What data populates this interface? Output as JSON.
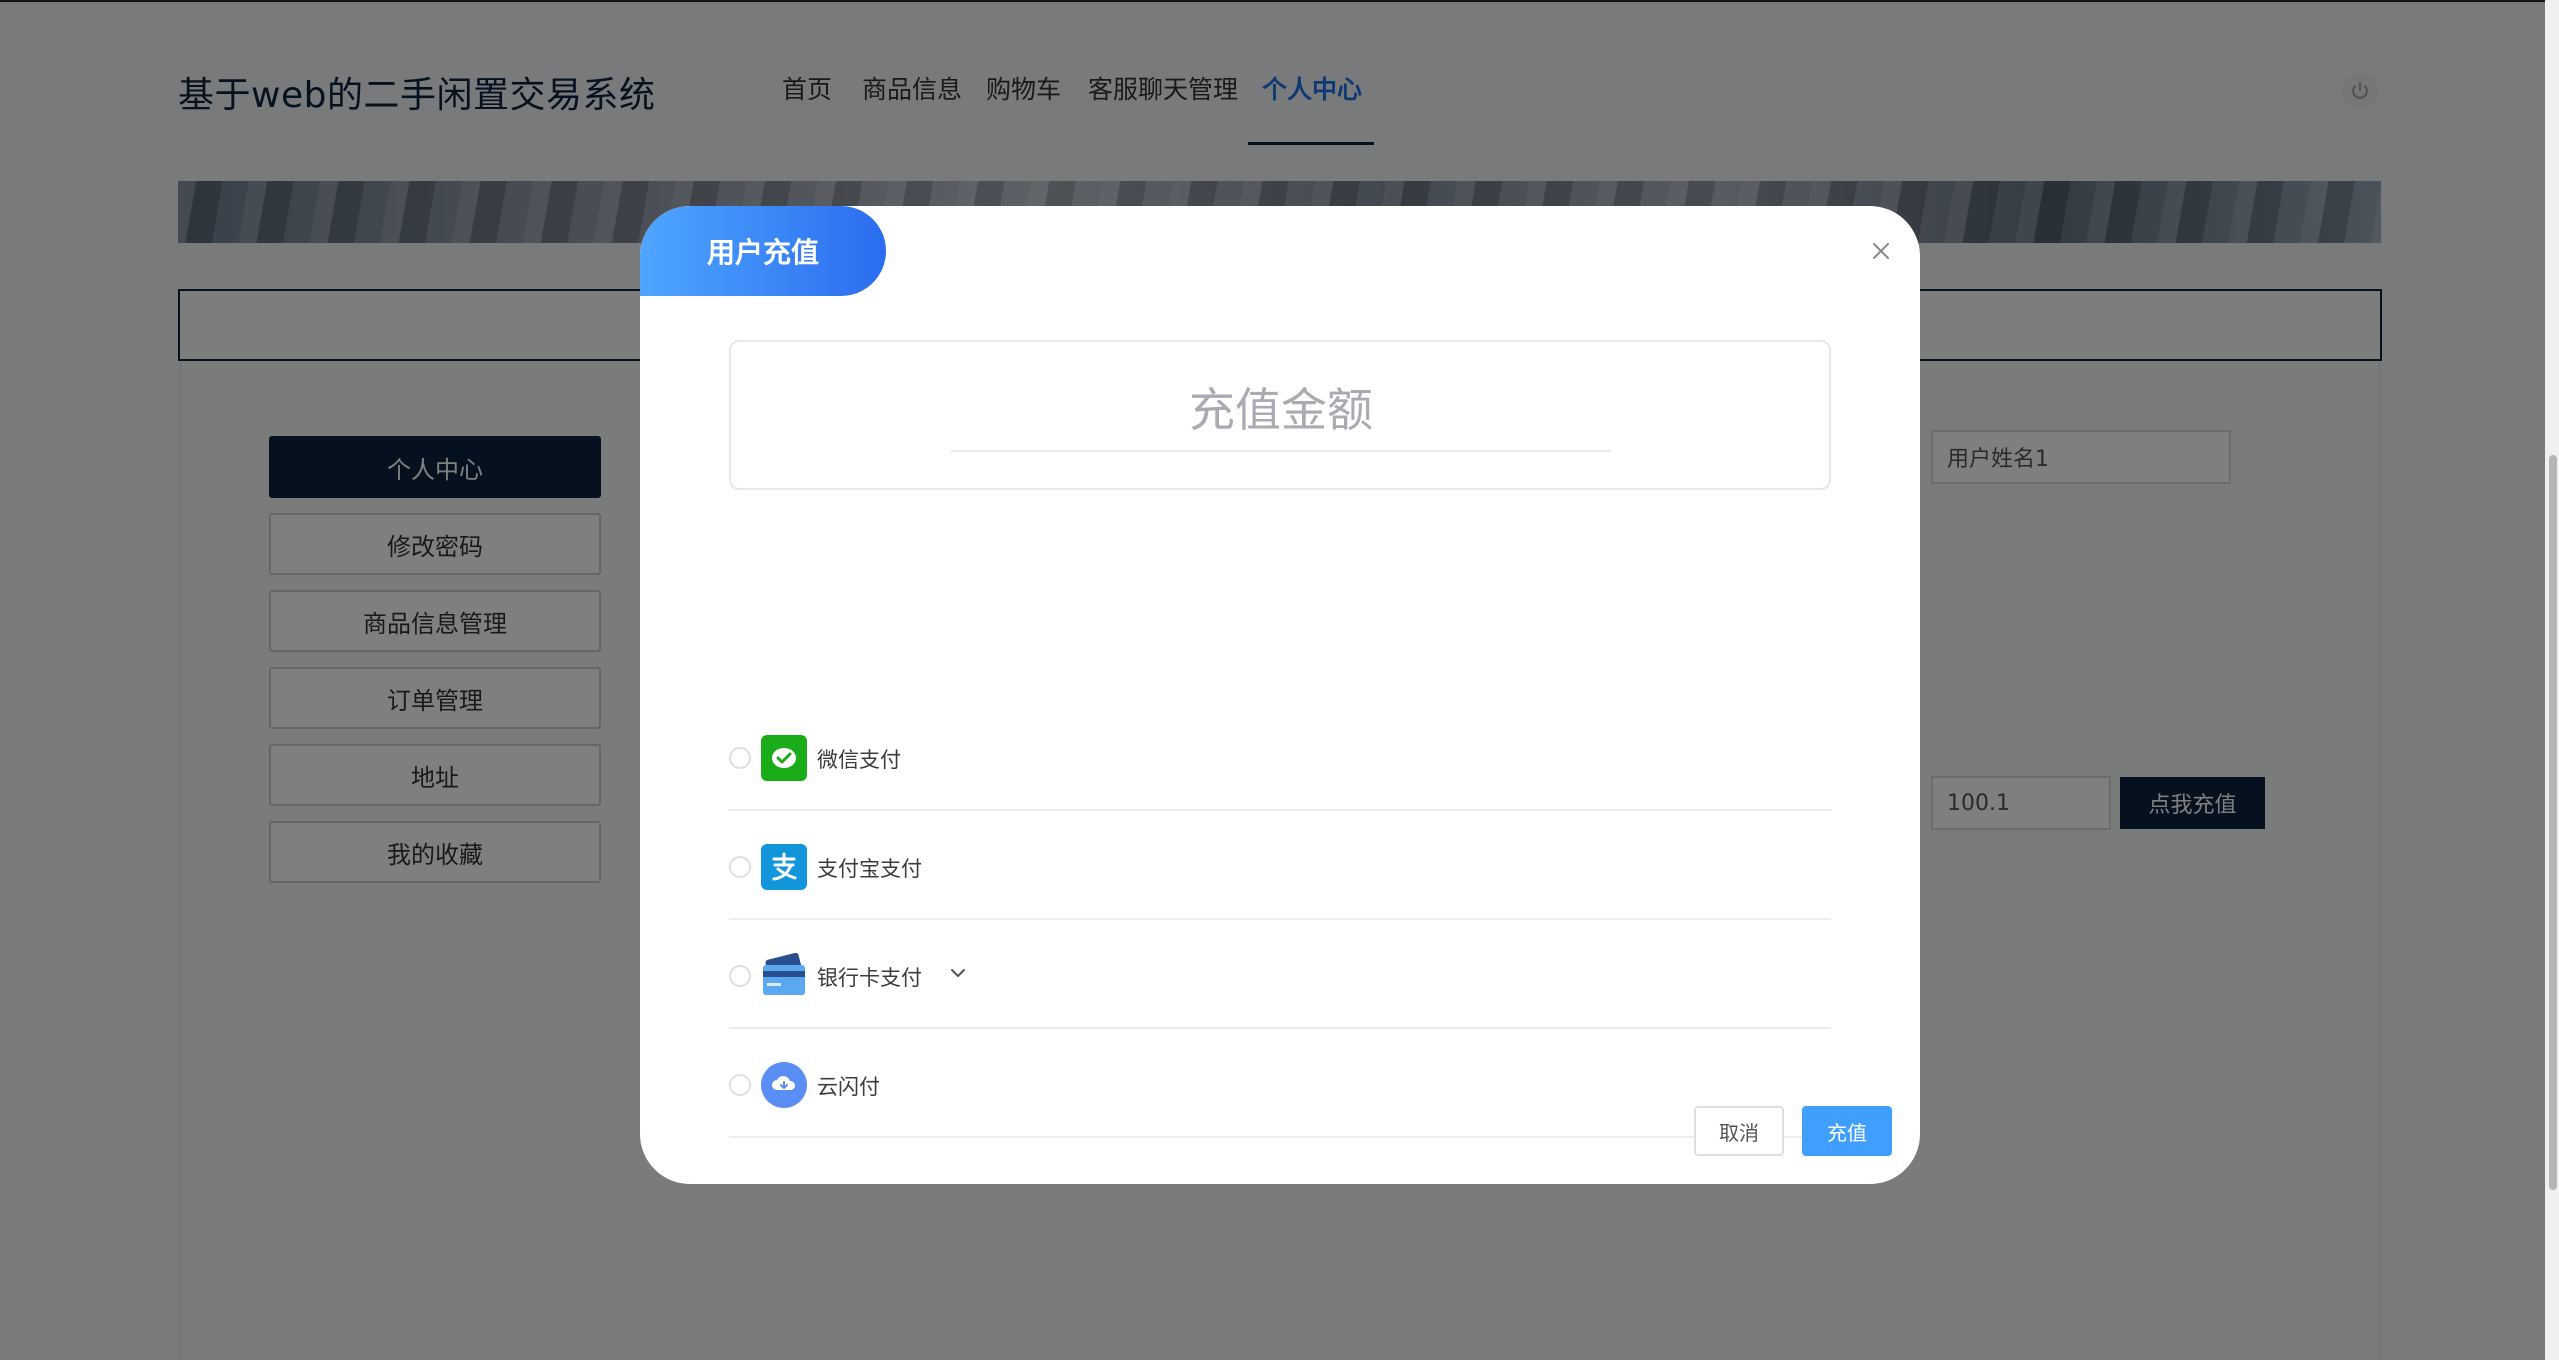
{
  "site": {
    "title": "基于web的二手闲置交易系统"
  },
  "nav": {
    "items": [
      {
        "label": "首页"
      },
      {
        "label": "商品信息"
      },
      {
        "label": "购物车"
      },
      {
        "label": "客服聊天管理"
      },
      {
        "label": "个人中心"
      }
    ],
    "active_index": 4
  },
  "sidebar": {
    "items": [
      {
        "label": "个人中心"
      },
      {
        "label": "修改密码"
      },
      {
        "label": "商品信息管理"
      },
      {
        "label": "订单管理"
      },
      {
        "label": "地址"
      },
      {
        "label": "我的收藏"
      }
    ]
  },
  "profile": {
    "name_value": "用户姓名1",
    "balance_value": "100.1",
    "recharge_button": "点我充值"
  },
  "modal": {
    "title": "用户充值",
    "amount_placeholder": "充值金额",
    "payment_methods": [
      {
        "label": "微信支付",
        "icon": "wechat-pay-icon",
        "color": "#1aad19"
      },
      {
        "label": "支付宝支付",
        "icon": "alipay-icon",
        "color": "#1296db"
      },
      {
        "label": "银行卡支付",
        "icon": "bank-card-icon",
        "color": "#2d6fd6"
      },
      {
        "label": "云闪付",
        "icon": "unionpay-cloud-icon",
        "color": "#5b8ef4"
      }
    ],
    "cancel_label": "取消",
    "confirm_label": "充值"
  },
  "colors": {
    "brand_navy": "#0c2341",
    "accent_blue": "#409eff",
    "active_nav": "#1a73e8"
  }
}
